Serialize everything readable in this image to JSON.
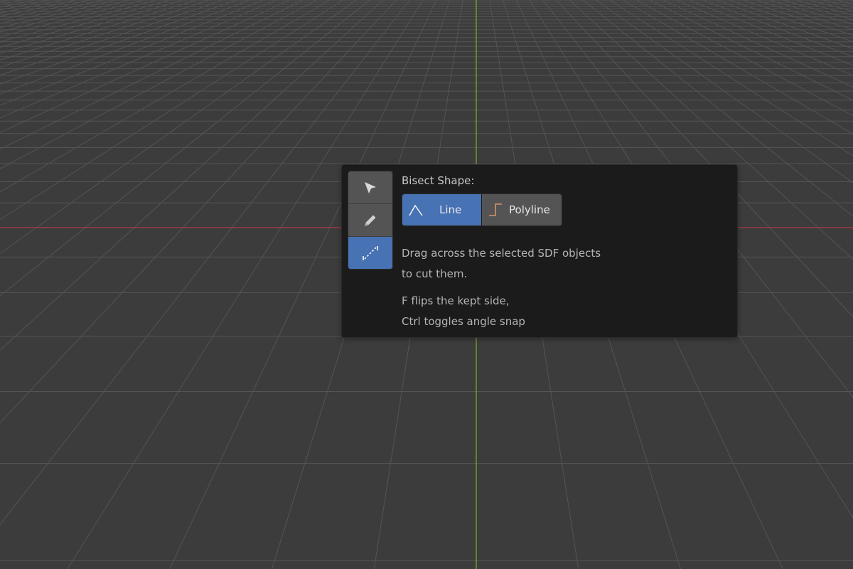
{
  "viewport": {
    "background": "#3c3c3c",
    "grid_color": "#545454",
    "x_axis_color": "#b13a42",
    "y_axis_color": "#7fae2c"
  },
  "toolbar": {
    "tools": [
      {
        "name": "select-tool",
        "icon": "cursor-arrow-icon",
        "active": false
      },
      {
        "name": "draw-tool",
        "icon": "pencil-icon",
        "active": false
      },
      {
        "name": "bisect-tool",
        "icon": "dashed-line-icon",
        "active": true
      }
    ]
  },
  "panel": {
    "heading": "Bisect Shape:",
    "shapes": {
      "line_label": "Line",
      "line_icon": "angle-line-icon",
      "polyline_label": "Polyline",
      "polyline_icon": "step-polyline-icon",
      "selected": "Line"
    },
    "help": {
      "line1": "Drag across the selected SDF objects",
      "line2": "to cut them.",
      "line3": "F flips the kept side,",
      "line4": "Ctrl toggles angle snap"
    }
  },
  "colors": {
    "accent": "#4772b3",
    "button": "#545454",
    "panel_bg": "#1b1b1b",
    "polyline_icon": "#d6926b"
  }
}
